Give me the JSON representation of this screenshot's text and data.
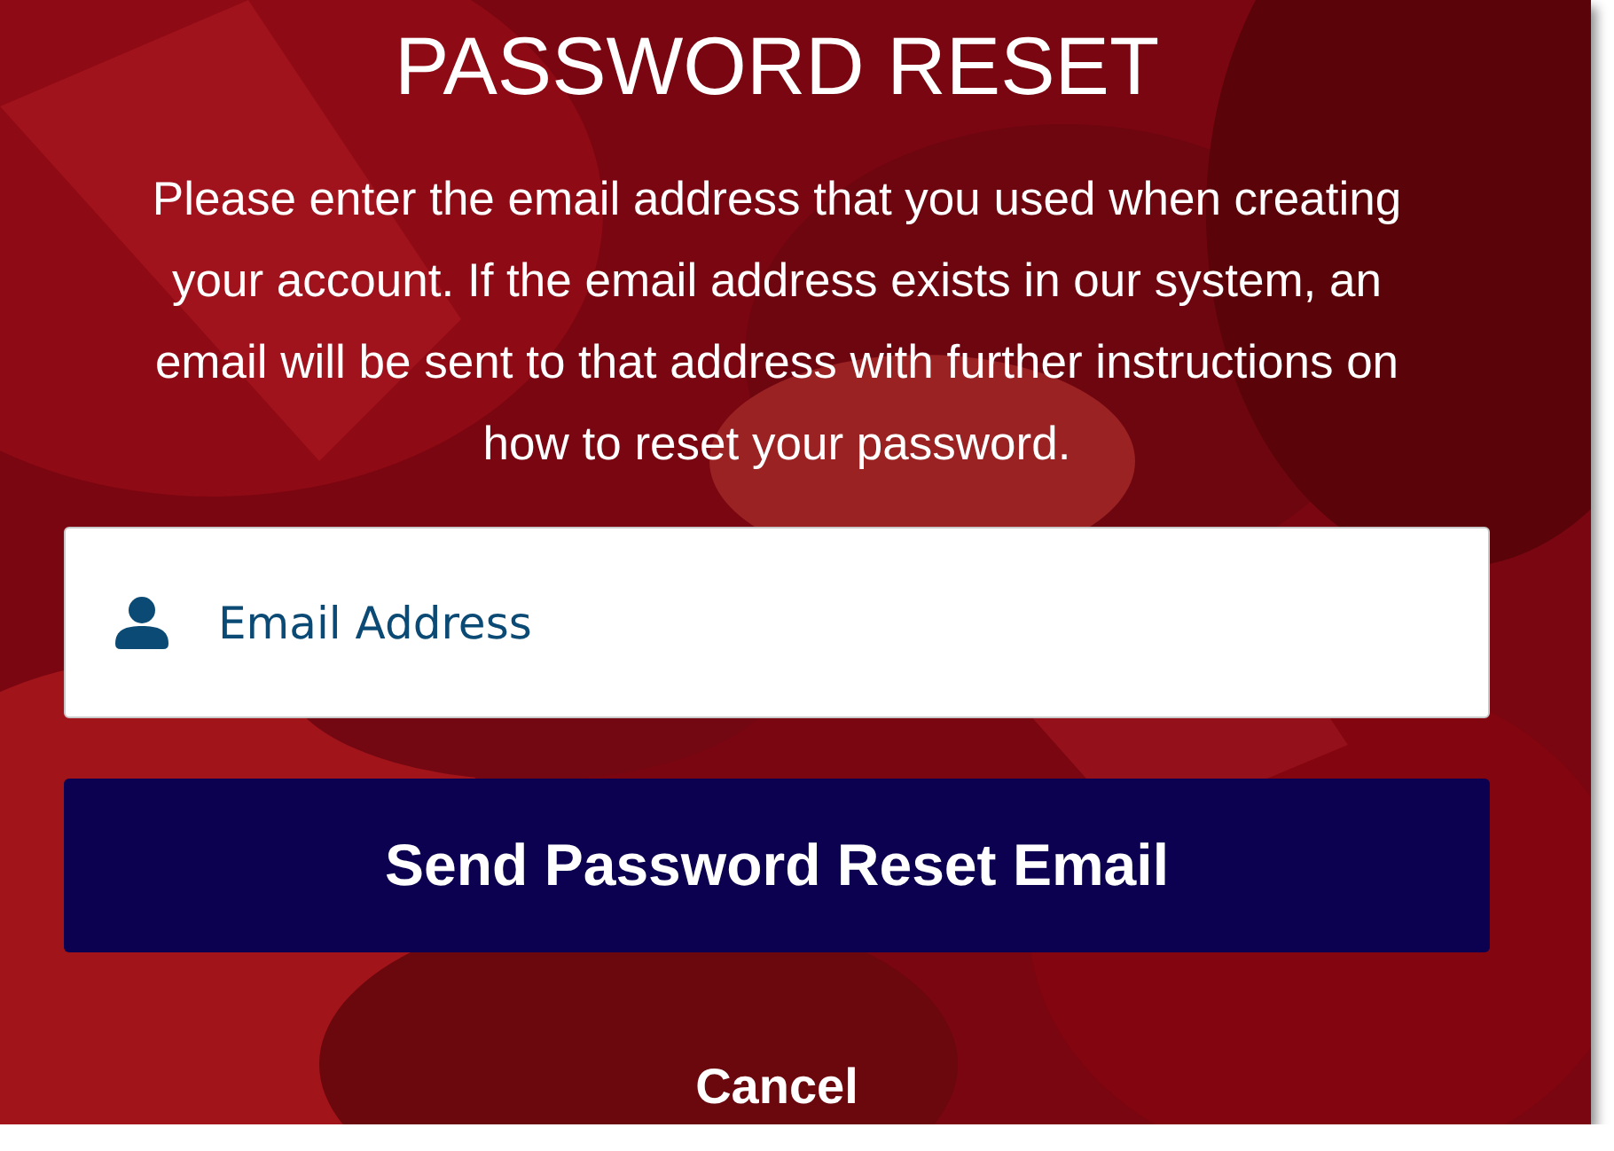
{
  "title": "PASSWORD RESET",
  "instructions": "Please enter the email address that you used when creating your account. If the email address exists in our system, an email will be sent to that address with further instructions on how to reset your password.",
  "email_field": {
    "placeholder": "Email Address"
  },
  "submit_button": {
    "label": "Send Password Reset Email"
  },
  "cancel_link": {
    "label": "Cancel"
  }
}
